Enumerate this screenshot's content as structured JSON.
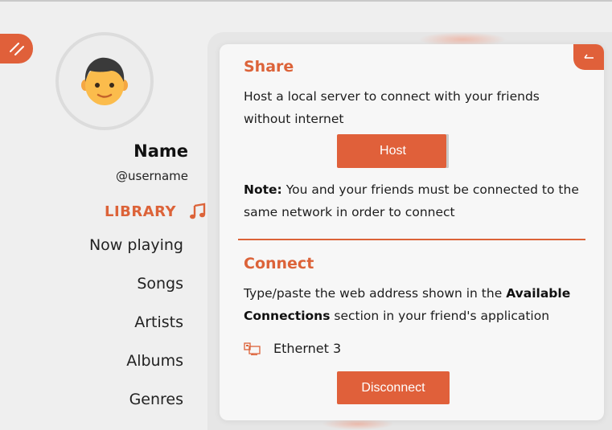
{
  "sidebar": {
    "menu_icon": "double-slash-icon",
    "avatar_icon": "person-avatar",
    "profile_name": "Name",
    "profile_username": "@username",
    "library_label": "LIBRARY",
    "library_icon": "music-note-icon",
    "nav": [
      {
        "label": "Now playing"
      },
      {
        "label": "Songs"
      },
      {
        "label": "Artists"
      },
      {
        "label": "Albums"
      },
      {
        "label": "Genres"
      }
    ]
  },
  "panel": {
    "collapse_icon": "arrow-left-icon",
    "share": {
      "title": "Share",
      "description": "Host a local server to connect with your friends without internet",
      "host_button": "Host",
      "note_label": "Note:",
      "note_text": "You and your friends must be connected to the same network in order to connect"
    },
    "connect": {
      "title": "Connect",
      "desc_part1": "Type/paste the web address shown in the ",
      "desc_bold": "Available Connections",
      "desc_part2": " section in your friend's application",
      "connection_icon": "ethernet-icon",
      "connection_name": "Ethernet 3",
      "disconnect_button": "Disconnect"
    }
  },
  "colors": {
    "accent": "#e0603a",
    "background": "#efefef",
    "card": "#f7f7f7"
  }
}
